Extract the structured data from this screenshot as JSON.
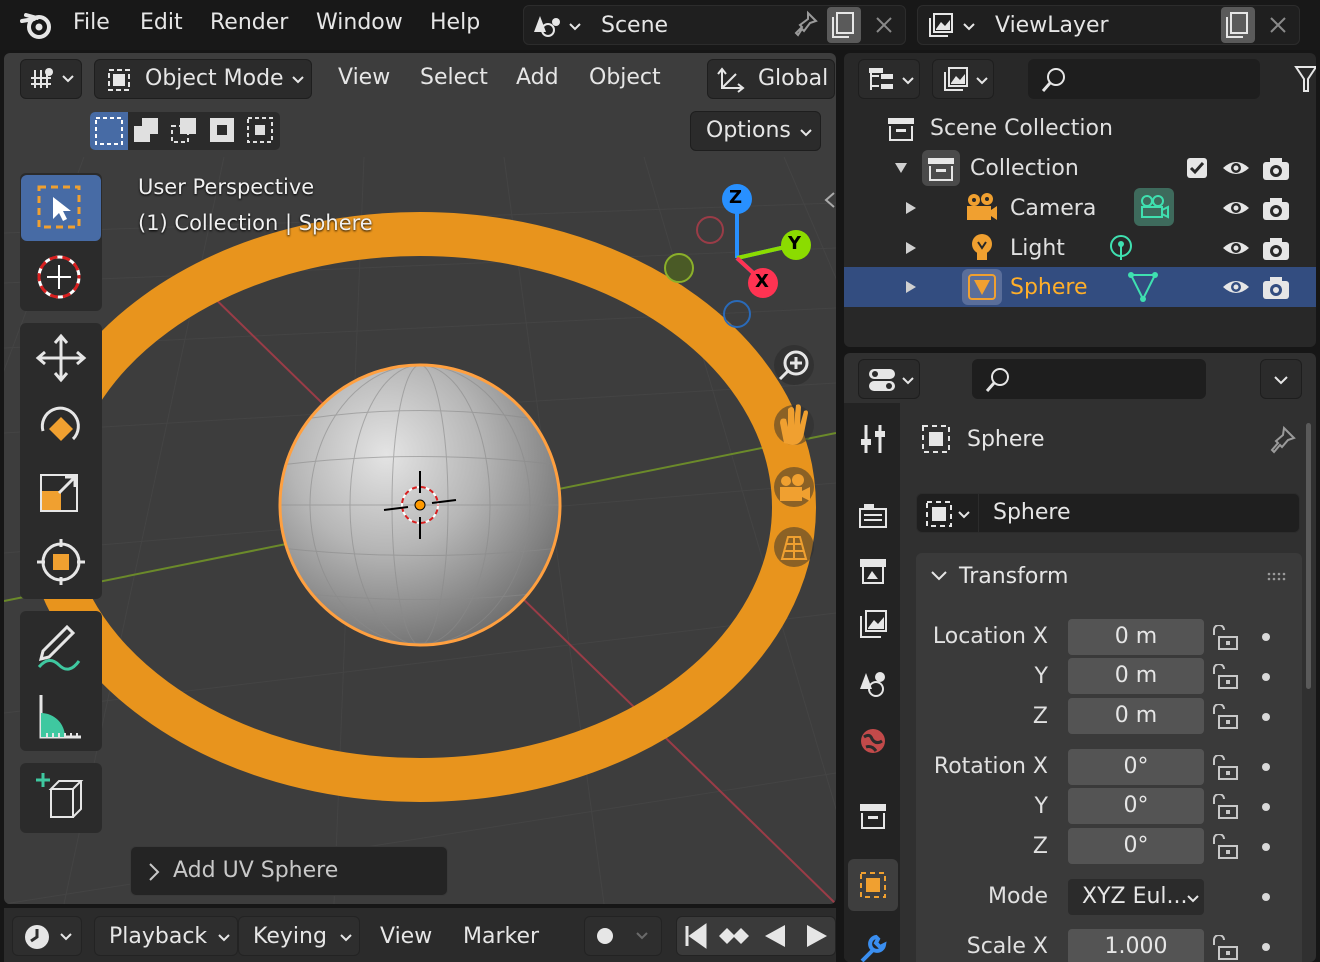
{
  "menu": {
    "file": "File",
    "edit": "Edit",
    "render": "Render",
    "window": "Window",
    "help": "Help"
  },
  "scene_selector": {
    "value": "Scene"
  },
  "viewlayer_selector": {
    "value": "ViewLayer"
  },
  "viewport": {
    "mode": "Object Mode",
    "menus": {
      "view": "View",
      "select": "Select",
      "add": "Add",
      "object": "Object"
    },
    "transform_orientation": "Global",
    "options": "Options",
    "overlay_line1": "User Perspective",
    "overlay_line2": "(1) Collection | Sphere",
    "gizmo": {
      "x": "X",
      "y": "Y",
      "z": "Z"
    },
    "redo_panel": "Add UV Sphere"
  },
  "timeline": {
    "playback": "Playback",
    "keying": "Keying",
    "view": "View",
    "marker": "Marker"
  },
  "outliner": {
    "scene_collection": "Scene Collection",
    "collection": "Collection",
    "items": [
      {
        "label": "Camera"
      },
      {
        "label": "Light"
      },
      {
        "label": "Sphere"
      }
    ]
  },
  "properties": {
    "object_name": "Sphere",
    "datablock_name": "Sphere",
    "panel_title": "Transform",
    "location": {
      "label": "Location X",
      "x": "0 m",
      "y": "0 m",
      "z": "0 m"
    },
    "rotation": {
      "label": "Rotation X",
      "x": "0°",
      "y": "0°",
      "z": "0°"
    },
    "axis_y": "Y",
    "axis_z": "Z",
    "mode_label": "Mode",
    "mode_value": "XYZ Eul...",
    "scale": {
      "label": "Scale X",
      "x": "1.000"
    }
  },
  "colors": {
    "accent_selected": "#334d80",
    "highlight_orange": "#ffaf29",
    "ring_orange": "#e8941d",
    "axis_x": "#ff3352",
    "axis_y": "#8bdc00",
    "axis_z": "#2890ff"
  }
}
